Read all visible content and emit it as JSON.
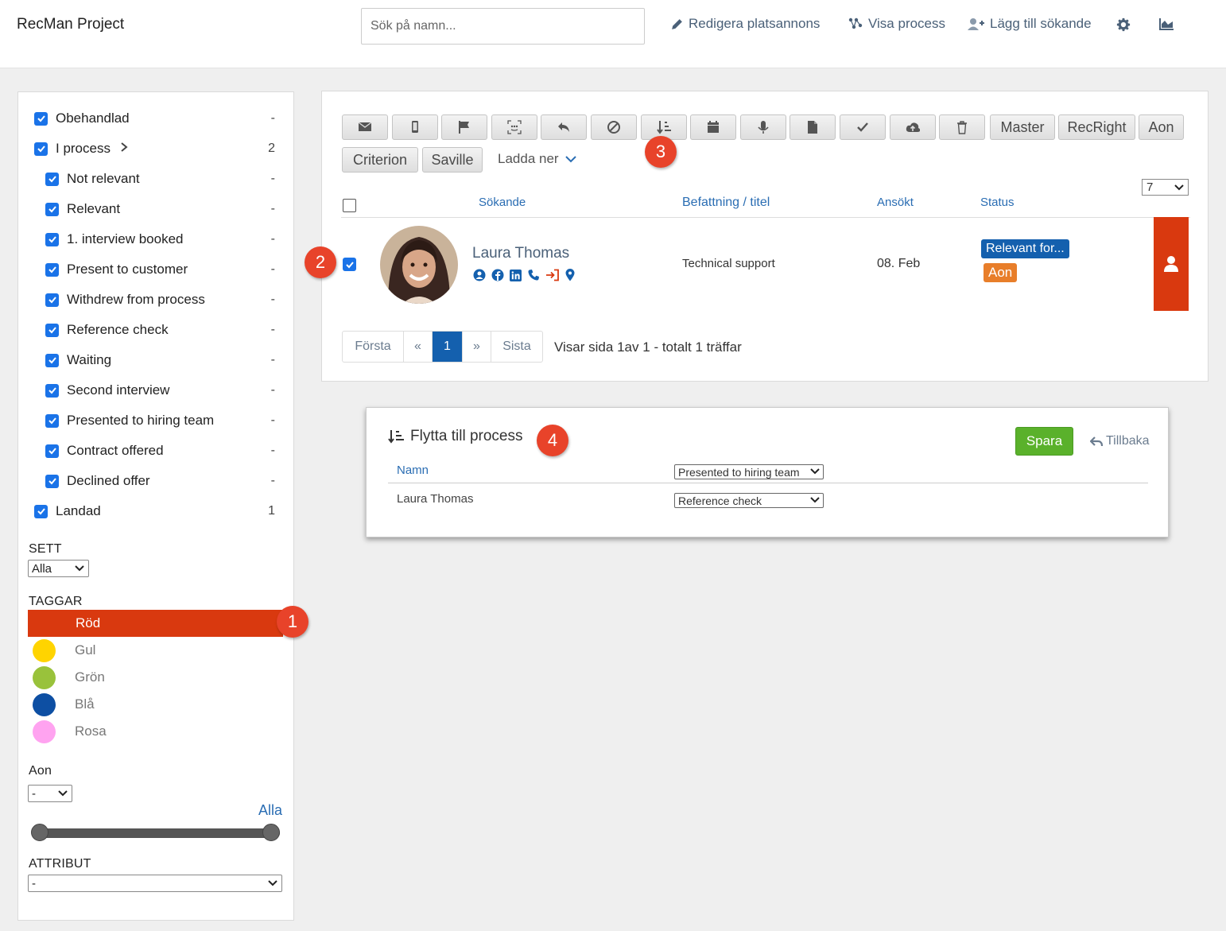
{
  "app_title": "RecMan Project",
  "search": {
    "placeholder": "Sök på namn..."
  },
  "nav": {
    "edit_ad": "Redigera platsannons",
    "show_process": "Visa process",
    "add_applicant": "Lägg till sökande",
    "settings_icon": "gear-icon",
    "stats_icon": "chart-icon"
  },
  "sidebar": {
    "filters": [
      {
        "label": "Obehandlad",
        "count": "-",
        "checked": true,
        "indent": 0
      },
      {
        "label": "I process",
        "count": "2",
        "checked": true,
        "indent": 0,
        "expandable": true
      },
      {
        "label": "Not relevant",
        "count": "-",
        "checked": true,
        "indent": 1
      },
      {
        "label": "Relevant",
        "count": "-",
        "checked": true,
        "indent": 1
      },
      {
        "label": "1. interview booked",
        "count": "-",
        "checked": true,
        "indent": 1
      },
      {
        "label": "Present to customer",
        "count": "-",
        "checked": true,
        "indent": 1
      },
      {
        "label": "Withdrew from process",
        "count": "-",
        "checked": true,
        "indent": 1
      },
      {
        "label": "Reference check",
        "count": "-",
        "checked": true,
        "indent": 1
      },
      {
        "label": "Waiting",
        "count": "-",
        "checked": true,
        "indent": 1
      },
      {
        "label": "Second interview",
        "count": "-",
        "checked": true,
        "indent": 1
      },
      {
        "label": "Presented to hiring team",
        "count": "-",
        "checked": true,
        "indent": 1
      },
      {
        "label": "Contract offered",
        "count": "-",
        "checked": true,
        "indent": 1
      },
      {
        "label": "Declined offer",
        "count": "-",
        "checked": true,
        "indent": 1
      },
      {
        "label": "Landad",
        "count": "1",
        "checked": true,
        "indent": 0
      }
    ],
    "sett_label": "SETT",
    "sett_value": "Alla",
    "taggar_label": "TAGGAR",
    "tags": [
      {
        "label": "Röd",
        "color": "#d9390f",
        "active": true
      },
      {
        "label": "Gul",
        "color": "#ffd400",
        "active": false
      },
      {
        "label": "Grön",
        "color": "#99c23b",
        "active": false
      },
      {
        "label": "Blå",
        "color": "#0d4fa3",
        "active": false
      },
      {
        "label": "Rosa",
        "color": "#ffa3f0",
        "active": false
      }
    ],
    "aon_label": "Aon",
    "aon_value": "-",
    "aon_range_link": "Alla",
    "attribut_label": "ATTRIBUT",
    "attribut_value": "-"
  },
  "toolbar": {
    "icon_buttons": [
      "mail-icon",
      "mobile-icon",
      "flag-icon",
      "face-scan-icon",
      "reply-icon",
      "block-icon",
      "sort-move-icon",
      "calendar-icon",
      "microphone-icon",
      "document-icon",
      "check-icon",
      "cloud-upload-icon",
      "trash-icon"
    ],
    "text_buttons": [
      "Master",
      "RecRight",
      "Aon",
      "Criterion",
      "Saville"
    ],
    "download_label": "Ladda ner"
  },
  "table": {
    "headers": {
      "applicant": "Sökande",
      "position": "Befattning / titel",
      "applied": "Ansökt",
      "status": "Status"
    },
    "per_page": "7",
    "rows": [
      {
        "name": "Laura Thomas",
        "position": "Technical support",
        "applied": "08. Feb",
        "status": "Relevant for...",
        "tag": "Aon",
        "checked": true,
        "contact_icons": [
          "user-circle-icon",
          "facebook-icon",
          "linkedin-icon",
          "phone-icon",
          "sign-in-icon",
          "location-pin-icon"
        ]
      }
    ]
  },
  "pagination": {
    "first": "Första",
    "prev": "«",
    "current": "1",
    "next": "»",
    "last": "Sista",
    "info_prefix": "Visar sida",
    "info_page": "1",
    "info_of": "av",
    "info_total_pages": "1",
    "info_total_label": "- totalt",
    "info_hits": "1",
    "info_suffix": "träffar"
  },
  "move_dialog": {
    "title": "Flytta till process",
    "save": "Spara",
    "back": "Tillbaka",
    "name_header": "Namn",
    "bulk_select": "Presented to hiring team",
    "rows": [
      {
        "name": "Laura Thomas",
        "process": "Reference check"
      }
    ]
  },
  "callouts": [
    "1",
    "2",
    "3",
    "4"
  ],
  "colors": {
    "accent_blue": "#1460ae",
    "tag_red": "#d9390f",
    "save_green": "#5ab12b",
    "aon_orange": "#e87e2a",
    "callout_red": "#e8432a"
  }
}
